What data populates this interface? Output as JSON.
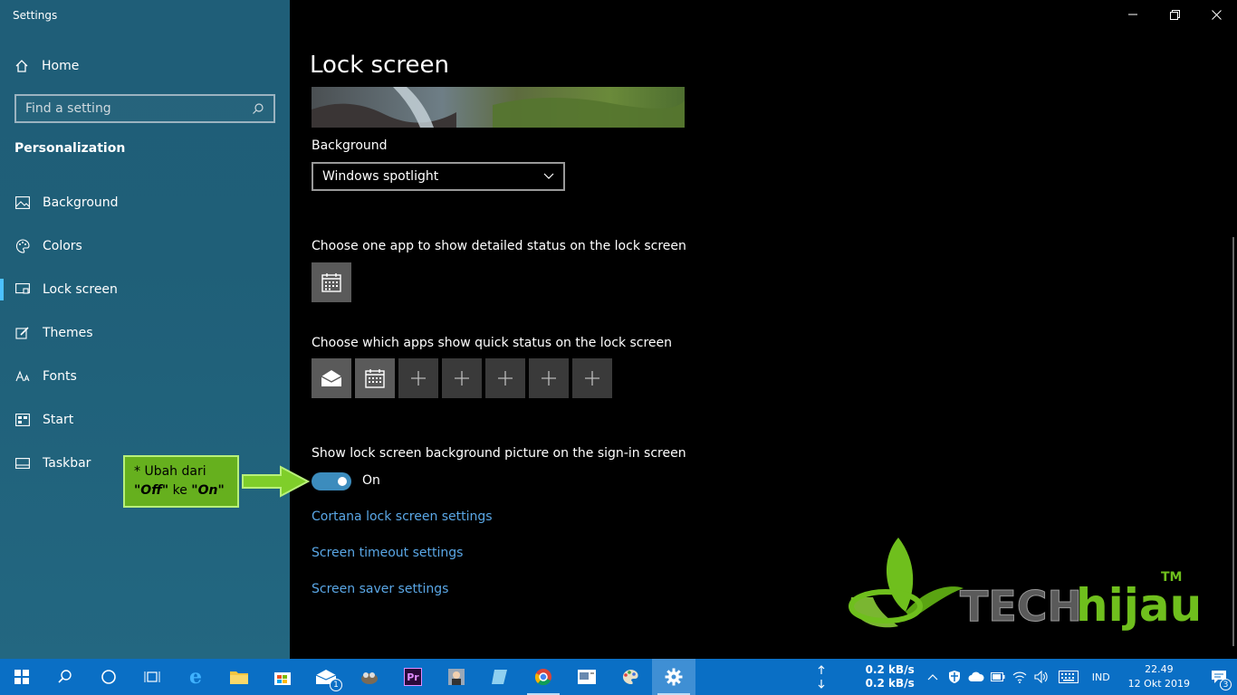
{
  "window": {
    "title": "Settings"
  },
  "sidebar": {
    "home_label": "Home",
    "search_placeholder": "Find a setting",
    "section_title": "Personalization",
    "items": [
      {
        "label": "Background",
        "icon": "image-icon"
      },
      {
        "label": "Colors",
        "icon": "palette-icon"
      },
      {
        "label": "Lock screen",
        "icon": "lock-screen-icon",
        "active": true
      },
      {
        "label": "Themes",
        "icon": "brush-icon"
      },
      {
        "label": "Fonts",
        "icon": "font-icon"
      },
      {
        "label": "Start",
        "icon": "start-icon"
      },
      {
        "label": "Taskbar",
        "icon": "taskbar-icon"
      }
    ]
  },
  "main": {
    "title": "Lock screen",
    "background_label": "Background",
    "background_value": "Windows spotlight",
    "detailed_status_label": "Choose one app to show detailed status on the lock screen",
    "quick_status_label": "Choose which apps show quick status on the lock screen",
    "signin_label": "Show lock screen background picture on the sign-in screen",
    "toggle_state": "On",
    "links": {
      "cortana": "Cortana lock screen settings",
      "timeout": "Screen timeout settings",
      "saver": "Screen saver settings"
    }
  },
  "callout": {
    "line1": "* Ubah dari",
    "off": "\"Off\"",
    "ke": "ke",
    "on": "\"On\""
  },
  "logo": {
    "text_a": "TECH",
    "text_b": "hijau",
    "tm": "TM"
  },
  "taskbar": {
    "net_up": "0.2 kB/s",
    "net_down": "0.2 kB/s",
    "language": "IND",
    "time": "22.49",
    "date": "12 Okt 2019",
    "mail_badge": "1",
    "notification_count": "3"
  },
  "colors": {
    "accent": "#0a6fc5",
    "link": "#5aa7e6",
    "toggle": "#3c8cbd",
    "sidebar": "#1f5e78"
  }
}
